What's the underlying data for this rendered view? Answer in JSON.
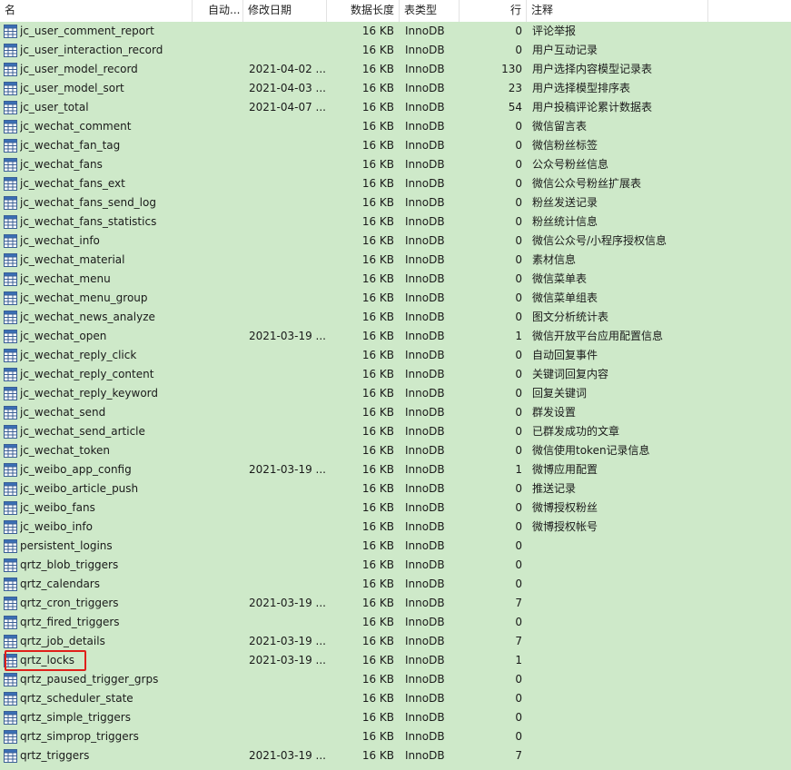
{
  "columns": {
    "name": "名",
    "auto_increment": "自动...",
    "modified": "修改日期",
    "data_length": "数据长度",
    "engine": "表类型",
    "rows": "行",
    "comment": "注释"
  },
  "tables": [
    {
      "name": "jc_user_comment_report",
      "date": "",
      "size": "16 KB",
      "engine": "InnoDB",
      "rows": "0",
      "comment": "评论举报"
    },
    {
      "name": "jc_user_interaction_record",
      "date": "",
      "size": "16 KB",
      "engine": "InnoDB",
      "rows": "0",
      "comment": "用户互动记录"
    },
    {
      "name": "jc_user_model_record",
      "date": "2021-04-02 ...",
      "size": "16 KB",
      "engine": "InnoDB",
      "rows": "130",
      "comment": "用户选择内容模型记录表"
    },
    {
      "name": "jc_user_model_sort",
      "date": "2021-04-03 ...",
      "size": "16 KB",
      "engine": "InnoDB",
      "rows": "23",
      "comment": "用户选择模型排序表"
    },
    {
      "name": "jc_user_total",
      "date": "2021-04-07 ...",
      "size": "16 KB",
      "engine": "InnoDB",
      "rows": "54",
      "comment": "用户投稿评论累计数据表"
    },
    {
      "name": "jc_wechat_comment",
      "date": "",
      "size": "16 KB",
      "engine": "InnoDB",
      "rows": "0",
      "comment": "微信留言表"
    },
    {
      "name": "jc_wechat_fan_tag",
      "date": "",
      "size": "16 KB",
      "engine": "InnoDB",
      "rows": "0",
      "comment": "微信粉丝标签"
    },
    {
      "name": "jc_wechat_fans",
      "date": "",
      "size": "16 KB",
      "engine": "InnoDB",
      "rows": "0",
      "comment": "公众号粉丝信息"
    },
    {
      "name": "jc_wechat_fans_ext",
      "date": "",
      "size": "16 KB",
      "engine": "InnoDB",
      "rows": "0",
      "comment": "微信公众号粉丝扩展表"
    },
    {
      "name": "jc_wechat_fans_send_log",
      "date": "",
      "size": "16 KB",
      "engine": "InnoDB",
      "rows": "0",
      "comment": "粉丝发送记录"
    },
    {
      "name": "jc_wechat_fans_statistics",
      "date": "",
      "size": "16 KB",
      "engine": "InnoDB",
      "rows": "0",
      "comment": "粉丝统计信息"
    },
    {
      "name": "jc_wechat_info",
      "date": "",
      "size": "16 KB",
      "engine": "InnoDB",
      "rows": "0",
      "comment": "微信公众号/小程序授权信息"
    },
    {
      "name": "jc_wechat_material",
      "date": "",
      "size": "16 KB",
      "engine": "InnoDB",
      "rows": "0",
      "comment": "素材信息"
    },
    {
      "name": "jc_wechat_menu",
      "date": "",
      "size": "16 KB",
      "engine": "InnoDB",
      "rows": "0",
      "comment": "微信菜单表"
    },
    {
      "name": "jc_wechat_menu_group",
      "date": "",
      "size": "16 KB",
      "engine": "InnoDB",
      "rows": "0",
      "comment": "微信菜单组表"
    },
    {
      "name": "jc_wechat_news_analyze",
      "date": "",
      "size": "16 KB",
      "engine": "InnoDB",
      "rows": "0",
      "comment": "图文分析统计表"
    },
    {
      "name": "jc_wechat_open",
      "date": "2021-03-19 ...",
      "size": "16 KB",
      "engine": "InnoDB",
      "rows": "1",
      "comment": "微信开放平台应用配置信息"
    },
    {
      "name": "jc_wechat_reply_click",
      "date": "",
      "size": "16 KB",
      "engine": "InnoDB",
      "rows": "0",
      "comment": "自动回复事件"
    },
    {
      "name": "jc_wechat_reply_content",
      "date": "",
      "size": "16 KB",
      "engine": "InnoDB",
      "rows": "0",
      "comment": "关键词回复内容"
    },
    {
      "name": "jc_wechat_reply_keyword",
      "date": "",
      "size": "16 KB",
      "engine": "InnoDB",
      "rows": "0",
      "comment": "回复关键词"
    },
    {
      "name": "jc_wechat_send",
      "date": "",
      "size": "16 KB",
      "engine": "InnoDB",
      "rows": "0",
      "comment": "群发设置"
    },
    {
      "name": "jc_wechat_send_article",
      "date": "",
      "size": "16 KB",
      "engine": "InnoDB",
      "rows": "0",
      "comment": "已群发成功的文章"
    },
    {
      "name": "jc_wechat_token",
      "date": "",
      "size": "16 KB",
      "engine": "InnoDB",
      "rows": "0",
      "comment": "微信使用token记录信息"
    },
    {
      "name": "jc_weibo_app_config",
      "date": "2021-03-19 ...",
      "size": "16 KB",
      "engine": "InnoDB",
      "rows": "1",
      "comment": "微博应用配置"
    },
    {
      "name": "jc_weibo_article_push",
      "date": "",
      "size": "16 KB",
      "engine": "InnoDB",
      "rows": "0",
      "comment": "推送记录"
    },
    {
      "name": "jc_weibo_fans",
      "date": "",
      "size": "16 KB",
      "engine": "InnoDB",
      "rows": "0",
      "comment": "微博授权粉丝"
    },
    {
      "name": "jc_weibo_info",
      "date": "",
      "size": "16 KB",
      "engine": "InnoDB",
      "rows": "0",
      "comment": "微博授权帐号"
    },
    {
      "name": "persistent_logins",
      "date": "",
      "size": "16 KB",
      "engine": "InnoDB",
      "rows": "0",
      "comment": ""
    },
    {
      "name": "qrtz_blob_triggers",
      "date": "",
      "size": "16 KB",
      "engine": "InnoDB",
      "rows": "0",
      "comment": ""
    },
    {
      "name": "qrtz_calendars",
      "date": "",
      "size": "16 KB",
      "engine": "InnoDB",
      "rows": "0",
      "comment": ""
    },
    {
      "name": "qrtz_cron_triggers",
      "date": "2021-03-19 ...",
      "size": "16 KB",
      "engine": "InnoDB",
      "rows": "7",
      "comment": ""
    },
    {
      "name": "qrtz_fired_triggers",
      "date": "",
      "size": "16 KB",
      "engine": "InnoDB",
      "rows": "0",
      "comment": ""
    },
    {
      "name": "qrtz_job_details",
      "date": "2021-03-19 ...",
      "size": "16 KB",
      "engine": "InnoDB",
      "rows": "7",
      "comment": ""
    },
    {
      "name": "qrtz_locks",
      "date": "2021-03-19 ...",
      "size": "16 KB",
      "engine": "InnoDB",
      "rows": "1",
      "comment": ""
    },
    {
      "name": "qrtz_paused_trigger_grps",
      "date": "",
      "size": "16 KB",
      "engine": "InnoDB",
      "rows": "0",
      "comment": ""
    },
    {
      "name": "qrtz_scheduler_state",
      "date": "",
      "size": "16 KB",
      "engine": "InnoDB",
      "rows": "0",
      "comment": ""
    },
    {
      "name": "qrtz_simple_triggers",
      "date": "",
      "size": "16 KB",
      "engine": "InnoDB",
      "rows": "0",
      "comment": ""
    },
    {
      "name": "qrtz_simprop_triggers",
      "date": "",
      "size": "16 KB",
      "engine": "InnoDB",
      "rows": "0",
      "comment": ""
    },
    {
      "name": "qrtz_triggers",
      "date": "2021-03-19 ...",
      "size": "16 KB",
      "engine": "InnoDB",
      "rows": "7",
      "comment": ""
    }
  ],
  "icon": "table-grid-icon",
  "colors": {
    "row_background": "#cee9c9",
    "highlight_border": "#e0201a"
  }
}
